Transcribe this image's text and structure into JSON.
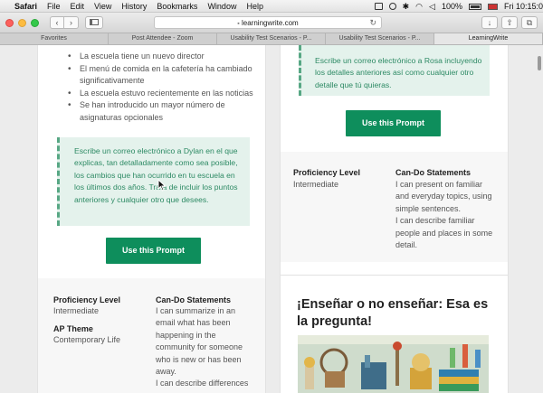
{
  "menubar": {
    "app": "Safari",
    "items": [
      "File",
      "Edit",
      "View",
      "History",
      "Bookmarks",
      "Window",
      "Help"
    ],
    "battery": "100%",
    "clock": "Fri 10:15:0"
  },
  "toolbar": {
    "url": "learningwrite.com"
  },
  "tabs": [
    "Favorites",
    "Post Attendee - Zoom",
    "Usability Test Scenarios - P...",
    "Usability Test Scenarios - P...",
    "LearningWrite"
  ],
  "left_card": {
    "bullets": [
      "La escuela tiene un nuevo director",
      "El menú de comida en la cafetería ha cambiado significativamente",
      "La escuela estuvo recientemente en las noticias",
      "Se han introducido un mayor número de asignaturas opcionales"
    ],
    "prompt": "Escribe un correo electrónico a Dylan en el que explicas, tan detalladamente como sea posible, los cambios que han ocurrido en tu escuela en los últimos dos años. Trata de incluir los puntos anteriores y cualquier otro que desees.",
    "button": "Use this Prompt",
    "proficiency_label": "Proficiency Level",
    "proficiency_value": "Intermediate",
    "theme_label": "AP Theme",
    "theme_value": "Contemporary Life",
    "cando_label": "Can-Do Statements",
    "cando_value": "I can summarize in an email what has been happening in the community for someone who is new or has been away.\nI can describe differences"
  },
  "right_card": {
    "prompt": "Escribe un correo electrónico a Rosa incluyendo los detalles anteriores así como cualquier otro detalle que tú quieras.",
    "button": "Use this Prompt",
    "proficiency_label": "Proficiency Level",
    "proficiency_value": "Intermediate",
    "cando_label": "Can-Do Statements",
    "cando_value": "I can present on familiar and everyday topics, using simple sentences.\nI can describe familiar people and places in some detail."
  },
  "right_card2": {
    "heading": "¡Enseñar o no enseñar: Esa es la pregunta!"
  },
  "colors": {
    "accent": "#0e8e5c",
    "prompt_bg": "#e4f2ec",
    "prompt_text": "#2d8a64"
  }
}
